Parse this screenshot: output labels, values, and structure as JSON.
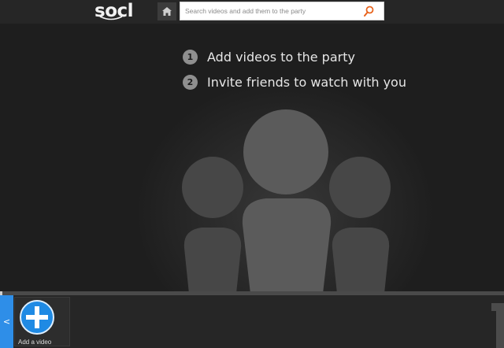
{
  "header": {
    "logo_text": "socl",
    "search": {
      "placeholder": "Search videos and add them to the party"
    }
  },
  "main": {
    "steps": [
      {
        "number": "1",
        "text": "Add videos to the party"
      },
      {
        "number": "2",
        "text": "Invite friends to watch with you"
      }
    ]
  },
  "tray": {
    "back_label": "<",
    "add_video_label": "Add a video"
  },
  "icons": {
    "home": "home-icon",
    "search": "search-icon",
    "add": "plus-icon",
    "people": "people-group-icon"
  },
  "colors": {
    "accent_blue": "#1f8ae4",
    "search_icon": "#e8641e",
    "background": "#1c1c1c",
    "header": "#262626"
  }
}
